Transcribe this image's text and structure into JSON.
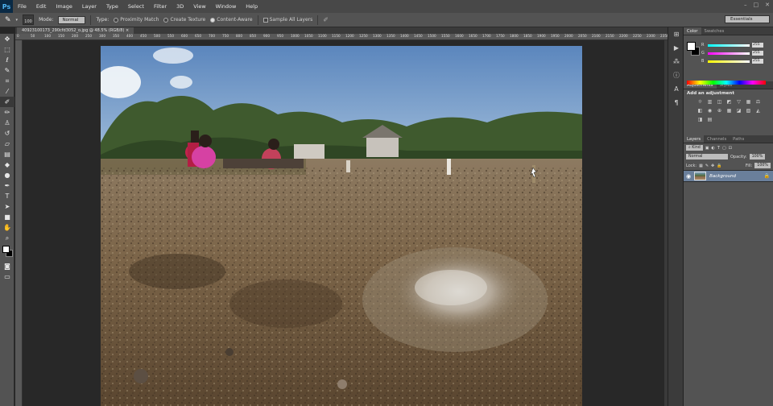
{
  "app": {
    "logo": "Ps"
  },
  "menu": [
    "File",
    "Edit",
    "Image",
    "Layer",
    "Type",
    "Select",
    "Filter",
    "3D",
    "View",
    "Window",
    "Help"
  ],
  "window_controls": {
    "minimize": "–",
    "maximize": "□",
    "close": "✕"
  },
  "options": {
    "brush_size": "100",
    "mode_label": "Mode:",
    "mode_value": "Normal",
    "type_label": "Type:",
    "types": [
      "Proximity Match",
      "Create Texture",
      "Content-Aware"
    ],
    "selected_type": "Content-Aware",
    "sample_label": "Sample All Layers",
    "workspace": "Essentials"
  },
  "document": {
    "tab_title": "40923100173_290cfd3052_o.jpg @ 48.5% (RGB/8)"
  },
  "ruler": {
    "ticks": [
      "0",
      "50",
      "100",
      "150",
      "200",
      "250",
      "300",
      "350",
      "400",
      "450",
      "500",
      "550",
      "600",
      "650",
      "700",
      "750",
      "800",
      "850",
      "900",
      "950",
      "1000",
      "1050",
      "1100",
      "1150",
      "1200",
      "1250",
      "1300",
      "1350",
      "1400",
      "1450",
      "1500",
      "1550",
      "1600",
      "1650",
      "1700",
      "1750",
      "1800",
      "1850",
      "1900",
      "1950",
      "2000",
      "2050",
      "2100",
      "2150",
      "2200",
      "2250",
      "2300",
      "2350"
    ]
  },
  "color_panel": {
    "tabs": [
      "Color",
      "Swatches"
    ],
    "channels": [
      {
        "name": "R",
        "value": "255",
        "color": "#ff0000"
      },
      {
        "name": "G",
        "value": "255",
        "color": "#00ff00"
      },
      {
        "name": "B",
        "value": "255",
        "color": "#0000ff"
      }
    ]
  },
  "adjustments_panel": {
    "tabs": [
      "Adjustments",
      "Styles"
    ],
    "title": "Add an adjustment"
  },
  "layers_panel": {
    "tabs": [
      "Layers",
      "Channels",
      "Paths"
    ],
    "filter_label": "Kind",
    "blend_mode": "Normal",
    "opacity_label": "Opacity:",
    "opacity_value": "100%",
    "lock_label": "Lock:",
    "fill_label": "Fill:",
    "fill_value": "100%",
    "layers": [
      {
        "name": "Background",
        "visible": true,
        "locked": true
      }
    ]
  }
}
